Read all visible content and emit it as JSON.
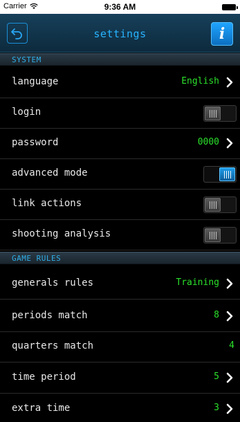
{
  "status_bar": {
    "carrier": "Carrier",
    "time": "9:36 AM"
  },
  "nav": {
    "title": "settings",
    "info_glyph": "i"
  },
  "sections": {
    "system": "SYSTEM",
    "game_rules": "GAME RULES"
  },
  "rows": {
    "language": {
      "label": "language",
      "value": "English"
    },
    "login": {
      "label": "login",
      "toggle": "off"
    },
    "password": {
      "label": "password",
      "value": "0000"
    },
    "advanced_mode": {
      "label": "advanced mode",
      "toggle": "on"
    },
    "link_actions": {
      "label": "link actions",
      "toggle": "off"
    },
    "shooting_analysis": {
      "label": "shooting analysis",
      "toggle": "off"
    },
    "generals_rules": {
      "label": "generals rules",
      "value": "Training"
    },
    "periods_match": {
      "label": "periods match",
      "value": "8"
    },
    "quarters_match": {
      "label": "quarters match",
      "value": "4"
    },
    "time_period": {
      "label": "time period",
      "value": "5"
    },
    "extra_time": {
      "label": "extra time",
      "value": "3"
    }
  },
  "colors": {
    "accent": "#27b4ff",
    "value_green": "#2be02b",
    "background": "#000000"
  },
  "icons": {
    "back": "back-arrow-icon",
    "info": "info-icon",
    "chevron": "chevron-right-icon",
    "wifi": "wifi-icon",
    "battery": "battery-icon"
  }
}
